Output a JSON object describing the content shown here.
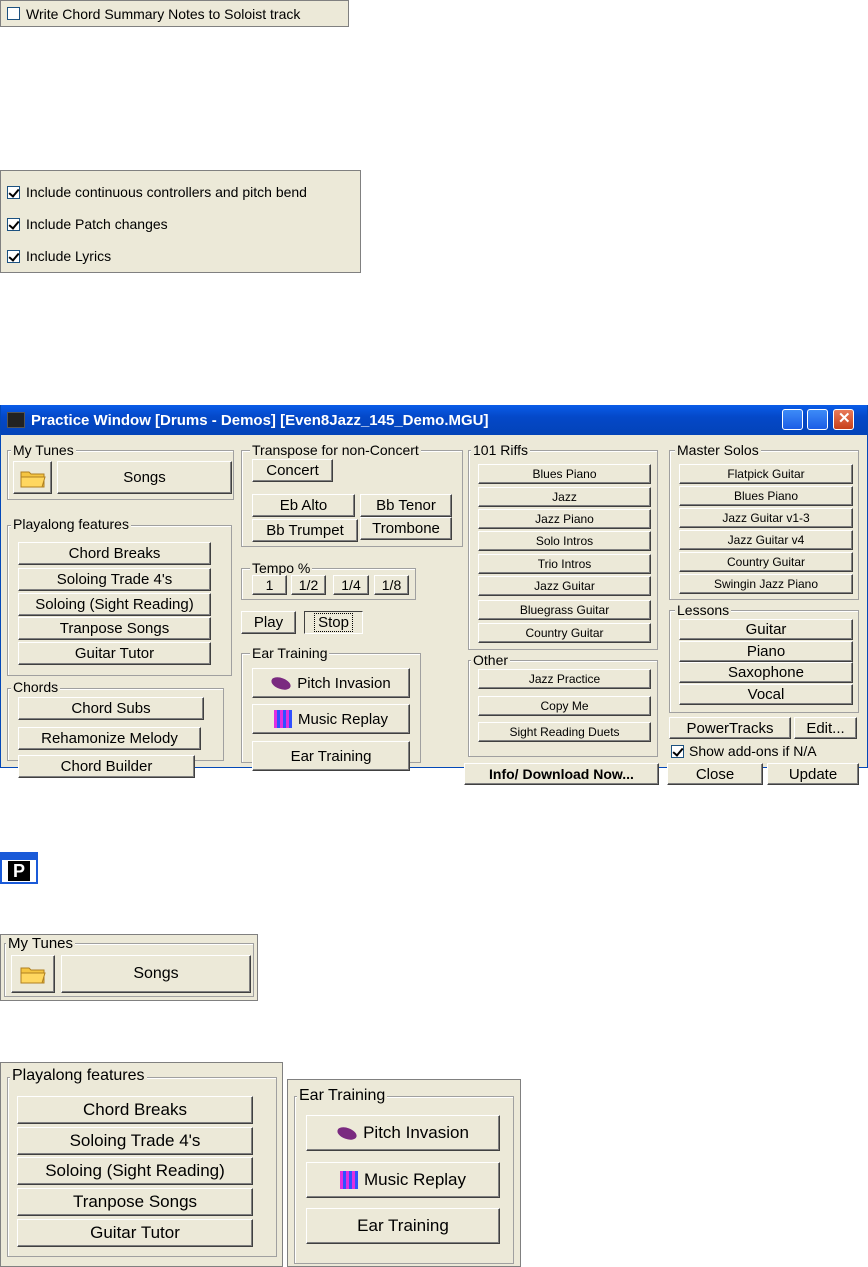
{
  "summary_checkbox": {
    "label": "Write Chord Summary Notes to Soloist track",
    "checked": false
  },
  "include_checkboxes": [
    {
      "label": "Include continuous controllers and pitch bend",
      "checked": true
    },
    {
      "label": "Include Patch changes",
      "checked": true
    },
    {
      "label": "Include Lyrics",
      "checked": true
    }
  ],
  "window": {
    "title": "Practice Window  [Drums - Demos]  [Even8Jazz_145_Demo.MGU]",
    "my_tunes": {
      "label": "My Tunes",
      "songs": "Songs"
    },
    "playalong": {
      "label": "Playalong features",
      "items": [
        "Chord Breaks",
        "Soloing Trade 4's",
        "Soloing (Sight Reading)",
        "Tranpose Songs",
        "Guitar Tutor"
      ]
    },
    "chords": {
      "label": "Chords",
      "items": [
        "Chord Subs",
        "Rehamonize Melody",
        "Chord Builder"
      ]
    },
    "transpose": {
      "label": "Transpose for non-Concert",
      "concert": "Concert",
      "eb_alto": "Eb Alto",
      "bb_tenor": "Bb Tenor",
      "bb_trumpet": "Bb Trumpet",
      "trombone": "Trombone"
    },
    "tempo": {
      "label": "Tempo %",
      "items": [
        "1",
        "1/2",
        "1/4",
        "1/8"
      ]
    },
    "play": "Play",
    "stop": "Stop",
    "ear_training": {
      "label": "Ear Training",
      "pitch_invasion": "Pitch Invasion",
      "music_replay": "Music Replay",
      "ear_training_btn": "Ear Training"
    },
    "riffs": {
      "label": "101 Riffs",
      "items": [
        "Blues Piano",
        "Jazz",
        "Jazz Piano",
        "Solo Intros",
        "Trio Intros",
        "Jazz Guitar",
        "Bluegrass Guitar",
        "Country Guitar"
      ]
    },
    "other": {
      "label": "Other",
      "items": [
        "Jazz Practice",
        "Copy Me",
        "Sight Reading Duets"
      ]
    },
    "info_download": "Info/ Download Now...",
    "master_solos": {
      "label": "Master Solos",
      "items": [
        "Flatpick Guitar",
        "Blues Piano",
        "Jazz Guitar v1-3",
        "Jazz Guitar v4",
        "Country Guitar",
        "Swingin Jazz Piano"
      ]
    },
    "lessons": {
      "label": "Lessons",
      "items": [
        "Guitar",
        "Piano",
        "Saxophone",
        "Vocal"
      ]
    },
    "powertracks": "PowerTracks",
    "edit": "Edit...",
    "show_addons": {
      "label": "Show add-ons if N/A",
      "checked": true
    },
    "close": "Close",
    "update": "Update"
  },
  "p_icon": {
    "letter": "P"
  },
  "zoom_my_tunes": {
    "label": "My Tunes",
    "songs": "Songs"
  },
  "zoom_playalong": {
    "label": "Playalong features",
    "items": [
      "Chord Breaks",
      "Soloing Trade 4's",
      "Soloing (Sight Reading)",
      "Tranpose Songs",
      "Guitar Tutor"
    ]
  },
  "zoom_ear_training": {
    "label": "Ear Training",
    "pitch_invasion": "Pitch Invasion",
    "music_replay": "Music Replay",
    "ear_training_btn": "Ear Training"
  }
}
